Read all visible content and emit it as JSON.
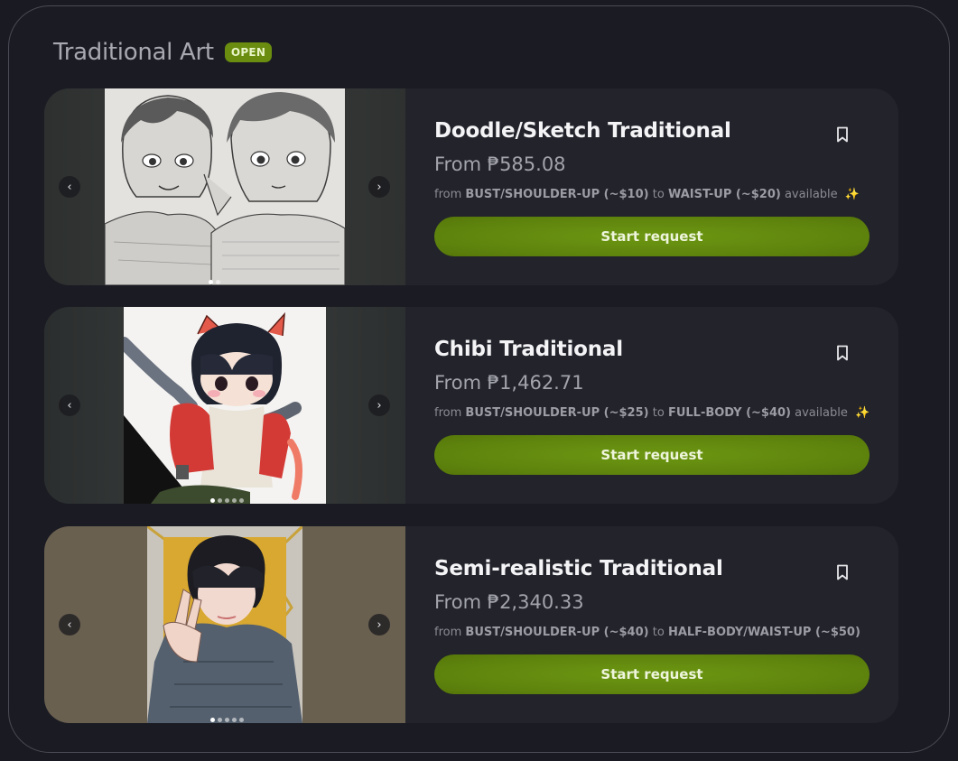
{
  "section": {
    "title": "Traditional Art",
    "badge": "OPEN"
  },
  "colors": {
    "accent": "#6a8d0f",
    "button": "#64890f",
    "card": "#22232b",
    "background": "#1b1c23"
  },
  "cards": [
    {
      "title": "Doodle/Sketch Traditional",
      "price": "From ₱585.08",
      "desc": {
        "from": "from",
        "size_a": "BUST/SHOULDER-UP (~$10)",
        "to": "to",
        "size_b": "WAIST-UP (~$20)",
        "suffix": "available",
        "sparkle": "✨"
      },
      "cta": "Start request",
      "nav_prev": "‹",
      "nav_next": "›",
      "image_icon": "sketch-artwork-image"
    },
    {
      "title": "Chibi Traditional",
      "price": "From ₱1,462.71",
      "desc": {
        "from": "from",
        "size_a": "BUST/SHOULDER-UP (~$25)",
        "to": "to",
        "size_b": "FULL-BODY (~$40)",
        "suffix": "available",
        "sparkle": "✨"
      },
      "cta": "Start request",
      "nav_prev": "‹",
      "nav_next": "›",
      "image_icon": "chibi-artwork-image"
    },
    {
      "title": "Semi-realistic Traditional",
      "price": "From ₱2,340.33",
      "desc": {
        "from": "from",
        "size_a": "BUST/SHOULDER-UP (~$40)",
        "to": "to",
        "size_b": "HALF-BODY/WAIST-UP (~$50)"
      },
      "cta": "Start request",
      "nav_prev": "‹",
      "nav_next": "›",
      "image_icon": "semi-realistic-artwork-image"
    }
  ]
}
